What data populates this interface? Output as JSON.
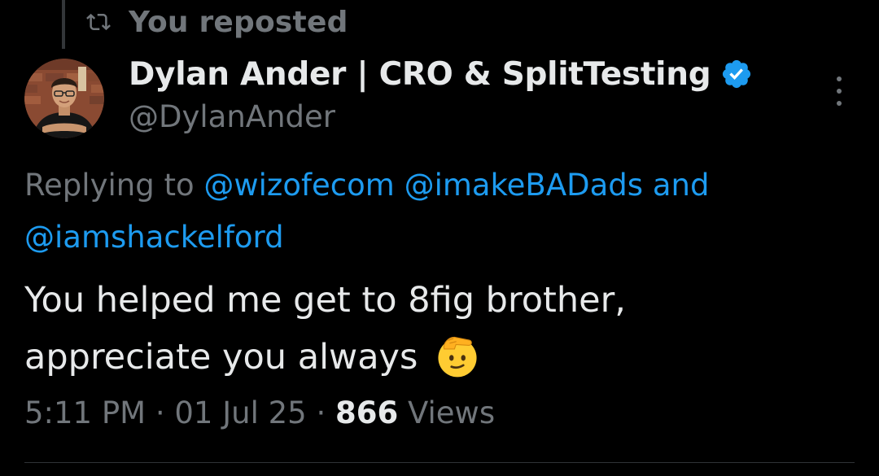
{
  "repost": {
    "label": "You reposted"
  },
  "author": {
    "display_name": "Dylan Ander | CRO & SplitTesting",
    "handle": "@DylanAnder",
    "verified": true,
    "badge_color": "#1d9bf0"
  },
  "reply": {
    "prefix": "Replying to",
    "mentions": [
      "@wizofecom",
      "@imakeBADads",
      "@iamshackelford"
    ],
    "conjunction": "and"
  },
  "tweet": {
    "text_line1": "You helped me get to 8fig brother,",
    "text_line2": "appreciate you always",
    "emoji": "saluting-face"
  },
  "meta": {
    "time": "5:11 PM",
    "date": "01 Jul 25",
    "separator": "·",
    "views_count": "866",
    "views_label": "Views"
  },
  "icons": {
    "repost": "repost-icon",
    "verified": "verified-badge-icon",
    "more": "more-options-icon"
  },
  "colors": {
    "background": "#000000",
    "primary_text": "#e7e9ea",
    "secondary_text": "#71767b",
    "link": "#1d9bf0"
  }
}
